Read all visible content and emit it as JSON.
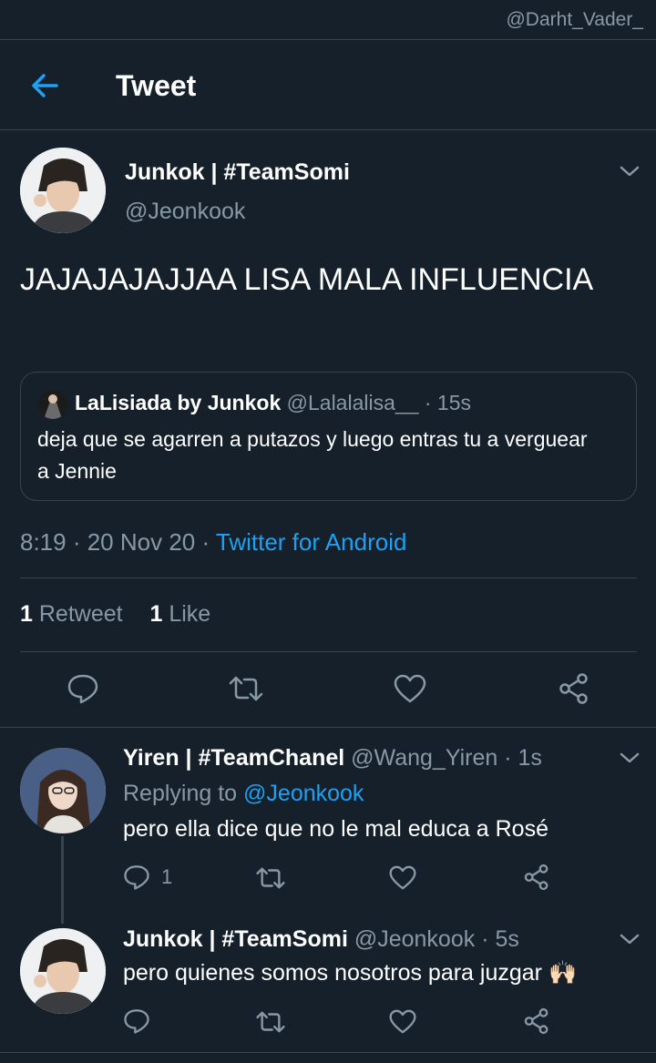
{
  "watermark": "@Darht_Vader_",
  "header": {
    "title": "Tweet"
  },
  "tweet": {
    "author_name": "Junkok | #TeamSomi",
    "author_handle": "@Jeonkook",
    "text": "JAJAJAJAJJAA LISA MALA INFLUENCIA",
    "quote": {
      "author_name": "LaLisiada by Junkok",
      "author_handle": "@Lalalalisa__",
      "time": "· 15s",
      "text": "deja que se agarren a putazos y luego entras tu a verguear a Jennie"
    },
    "time": "8:19 · 20 Nov 20 ·",
    "source": "Twitter for Android",
    "retweet_count": "1",
    "retweet_label": "Retweet",
    "like_count": "1",
    "like_label": "Like"
  },
  "replies": [
    {
      "author_name": "Yiren | #TeamChanel",
      "author_handle": "@Wang_Yiren",
      "time": "· 1s",
      "replying_prefix": "Replying to",
      "replying_to": "@Jeonkook",
      "text": "pero ella dice que no le mal educa a Rosé",
      "reply_count": "1"
    },
    {
      "author_name": "Junkok | #TeamSomi",
      "author_handle": "@Jeonkook",
      "time": "· 5s",
      "text": "pero quienes somos nosotros para juzgar",
      "emoji": "🙌🏻"
    }
  ],
  "colors": {
    "background": "#15202b",
    "accent": "#1da1f2",
    "secondary_text": "#8899a6",
    "divider": "#38444d"
  },
  "icons": [
    "back-arrow-icon",
    "chevron-down-icon",
    "reply-icon",
    "retweet-icon",
    "like-icon",
    "share-icon"
  ]
}
